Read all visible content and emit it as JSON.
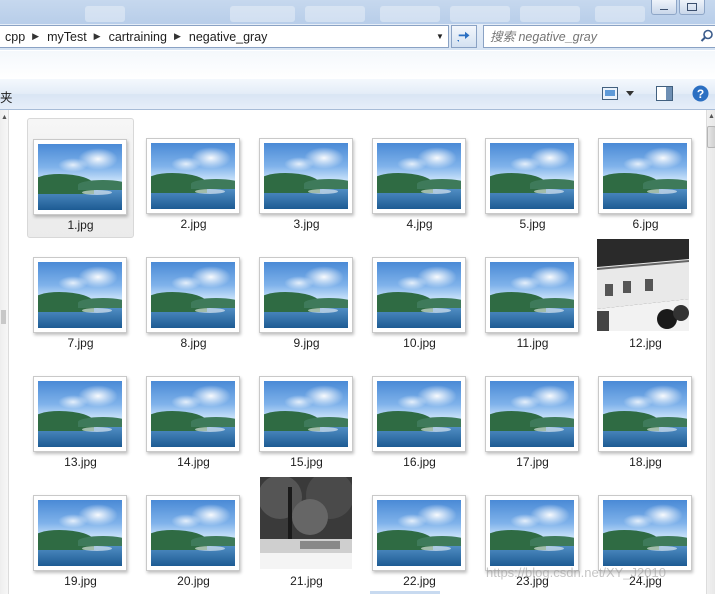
{
  "breadcrumb": [
    {
      "label": "cpp"
    },
    {
      "label": "myTest"
    },
    {
      "label": "cartraining"
    },
    {
      "label": "negative_gray"
    }
  ],
  "search": {
    "placeholder": "搜索 negative_gray"
  },
  "toolbar": {
    "partial_label": "夹"
  },
  "files": [
    {
      "name": "1.jpg",
      "thumbnail": "landscape",
      "selected": true
    },
    {
      "name": "2.jpg",
      "thumbnail": "landscape"
    },
    {
      "name": "3.jpg",
      "thumbnail": "landscape"
    },
    {
      "name": "4.jpg",
      "thumbnail": "landscape"
    },
    {
      "name": "5.jpg",
      "thumbnail": "landscape"
    },
    {
      "name": "6.jpg",
      "thumbnail": "landscape"
    },
    {
      "name": "7.jpg",
      "thumbnail": "landscape"
    },
    {
      "name": "8.jpg",
      "thumbnail": "landscape"
    },
    {
      "name": "9.jpg",
      "thumbnail": "landscape"
    },
    {
      "name": "10.jpg",
      "thumbnail": "landscape"
    },
    {
      "name": "11.jpg",
      "thumbnail": "landscape"
    },
    {
      "name": "12.jpg",
      "thumbnail": "grayscale-building-photo"
    },
    {
      "name": "13.jpg",
      "thumbnail": "landscape"
    },
    {
      "name": "14.jpg",
      "thumbnail": "landscape"
    },
    {
      "name": "15.jpg",
      "thumbnail": "landscape"
    },
    {
      "name": "16.jpg",
      "thumbnail": "landscape"
    },
    {
      "name": "17.jpg",
      "thumbnail": "landscape"
    },
    {
      "name": "18.jpg",
      "thumbnail": "landscape"
    },
    {
      "name": "19.jpg",
      "thumbnail": "landscape"
    },
    {
      "name": "20.jpg",
      "thumbnail": "landscape"
    },
    {
      "name": "21.jpg",
      "thumbnail": "grayscale-park-photo"
    },
    {
      "name": "22.jpg",
      "thumbnail": "landscape"
    },
    {
      "name": "23.jpg",
      "thumbnail": "landscape"
    },
    {
      "name": "24.jpg",
      "thumbnail": "landscape"
    }
  ],
  "watermark": "https://blog.csdn.net/XY_J2010",
  "icons": {
    "refresh": "refresh-icon",
    "search": "search-icon",
    "view": "change-view-icon",
    "preview": "preview-pane-icon",
    "help": "help-icon"
  },
  "colors": {
    "accent": "#2b6fc2",
    "selection_bg": "#ececec"
  }
}
